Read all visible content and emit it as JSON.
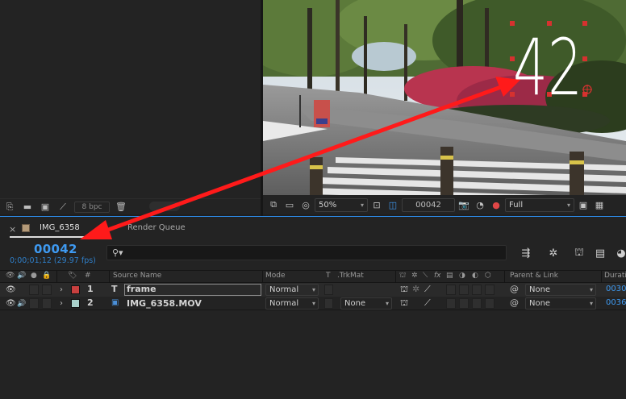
{
  "project_panel": {
    "bpc": "8 bpc"
  },
  "viewer": {
    "overlay_number": "42",
    "zoom": "50%",
    "timecode": "00042",
    "resolution": "Full"
  },
  "timeline": {
    "tab_close": "×",
    "tab_comp": "IMG_6358",
    "tab_render": "Render Queue",
    "current_time": "00042",
    "sub_time": "0;00;01;12 (29.97 fps)",
    "columns": {
      "num": "#",
      "source_name": "Source Name",
      "mode": "Mode",
      "t": "T",
      "trkmat": ".TrkMat",
      "fx": "fx",
      "parent": "Parent & Link",
      "duration": "Duration"
    },
    "layers": [
      {
        "num": "1",
        "type_icon": "T",
        "name": "frame",
        "mode": "Normal",
        "trkmat": "",
        "parent": "None",
        "duration": "0030",
        "color": "#c8403f"
      },
      {
        "num": "2",
        "type_icon": "▣",
        "name": "IMG_6358.MOV",
        "mode": "Normal",
        "trkmat": "None",
        "parent": "None",
        "duration": "0036",
        "color": "#a9d1cb"
      }
    ]
  },
  "colors": {
    "accent_blue": "#3e99f0",
    "arrow_red": "#ff1a1a"
  },
  "icons": [
    "eye-icon",
    "audio-icon",
    "solo-icon",
    "lock-icon",
    "label-icon",
    "search-icon",
    "text-layer-icon",
    "footage-icon",
    "pick-whip-icon",
    "camera-icon",
    "trash-icon",
    "folder-icon"
  ]
}
